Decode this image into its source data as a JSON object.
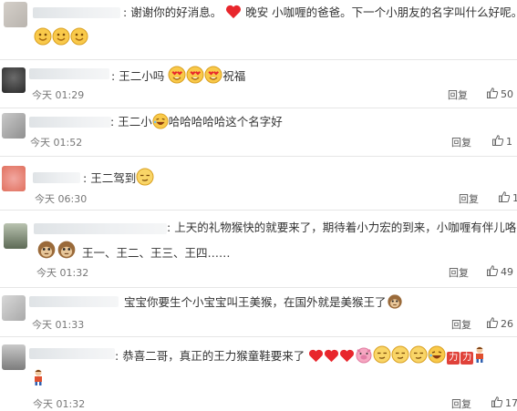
{
  "comments": [
    {
      "sep": ":",
      "text": "谢谢你的好消息。",
      "text2": "晚安 小咖喱的爸爸。下一个小朋友的名字叫什么好呢。"
    },
    {
      "sep": ":",
      "text": "王二小吗",
      "text2": "祝福",
      "time": "今天 01:29",
      "reply": "回复",
      "likes": "50"
    },
    {
      "sep": ":",
      "text": "王二小",
      "text2": "哈哈哈哈哈这个名字好",
      "time": "今天 01:52",
      "reply": "回复",
      "likes": "1"
    },
    {
      "sep": ":",
      "text": "王二驾到",
      "time": "今天 06:30",
      "reply": "回复",
      "likes": "1"
    },
    {
      "sep": ":",
      "text": "上天的礼物猴快的就要来了，期待着小力宏的到来，小咖喱有伴儿咯",
      "text2": "王一、王二、王三、王四……",
      "time": "今天 01:32",
      "reply": "回复",
      "likes": "49"
    },
    {
      "text": "宝宝你要生个小宝宝叫王美猴，在国外就是美猴王了",
      "time": "今天 01:33",
      "reply": "回复",
      "likes": "26"
    },
    {
      "sep": ":",
      "text": "恭喜二哥，真正的王力猴童鞋要来了",
      "tag1": "力",
      "tag2": "力",
      "time": "今天 01:32",
      "reply": "回复",
      "likes": "17"
    }
  ],
  "icons": {
    "like": "thumbs-up-icon",
    "emoji": "emoji-icon",
    "heart": "heart-icon"
  },
  "colors": {
    "text": "#333333",
    "meta": "#777777",
    "heart": "#e8262c",
    "emoji": "#f7c640",
    "tag": "#e0423a"
  }
}
